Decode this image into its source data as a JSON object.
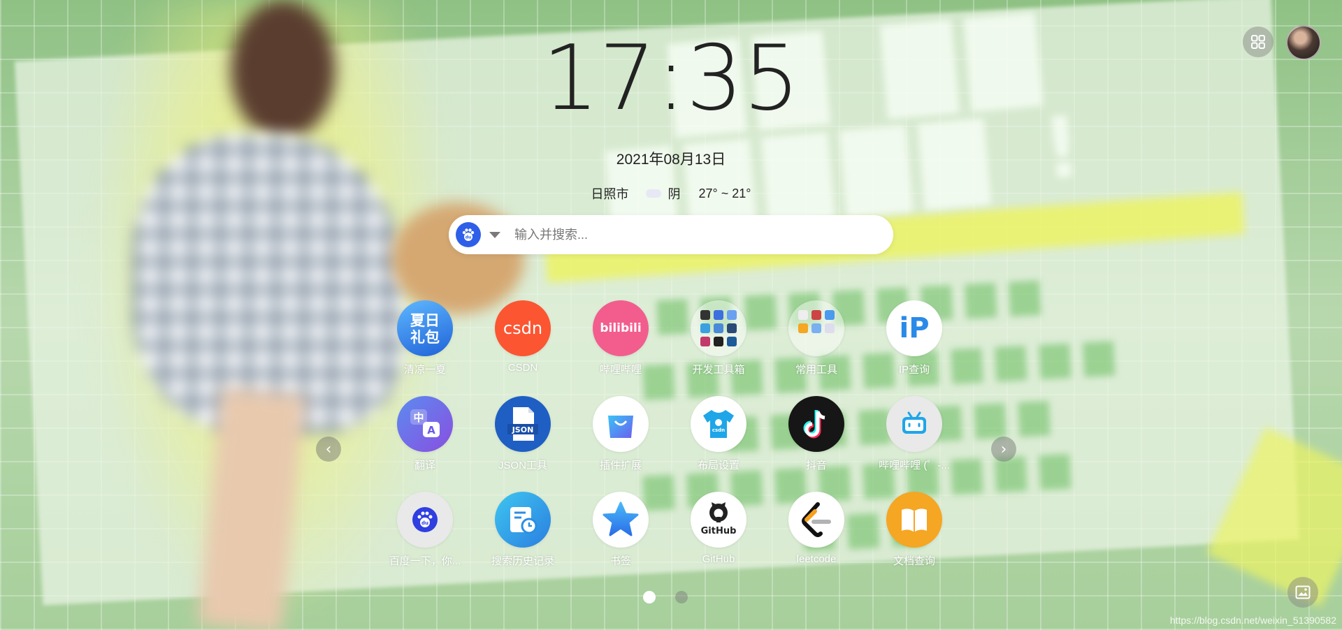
{
  "clock": {
    "time": "17:35",
    "date": "2021年08月13日"
  },
  "weather": {
    "city": "日照市",
    "condition": "阴",
    "temperature": "27° ~ 21°",
    "icon": "cloud-icon"
  },
  "search": {
    "placeholder": "输入并搜索...",
    "engine_icon": "baidu-paw-icon",
    "engine_label": "du"
  },
  "apps": [
    {
      "label": "清凉一夏",
      "icon": "summer-gift-icon",
      "badge": "夏日\n礼包",
      "color": "#2b7ee8"
    },
    {
      "label": "CSDN",
      "icon": "csdn-icon",
      "badge": "csdn",
      "color": "#fc5531"
    },
    {
      "label": "哔哩哔哩",
      "icon": "bilibili-icon",
      "badge": "bilibili",
      "color": "#f25d8e"
    },
    {
      "label": "开发工具箱",
      "icon": "folder-icon",
      "badge": "",
      "color": ""
    },
    {
      "label": "常用工具",
      "icon": "folder-icon",
      "badge": "",
      "color": ""
    },
    {
      "label": "IP查询",
      "icon": "ip-icon",
      "badge": "iP",
      "color": "#ffffff"
    },
    {
      "label": "翻译",
      "icon": "translate-icon",
      "badge": "中A",
      "color": "#6f5de8"
    },
    {
      "label": "JSON工具",
      "icon": "json-icon",
      "badge": "JSON",
      "color": "#1f5fc4"
    },
    {
      "label": "插件扩展",
      "icon": "shopping-bag-icon",
      "badge": "",
      "color": "#ffffff"
    },
    {
      "label": "布局设置",
      "icon": "tshirt-icon",
      "badge": "csdn",
      "color": "#ffffff"
    },
    {
      "label": "抖音",
      "icon": "tiktok-icon",
      "badge": "♪",
      "color": "#161616"
    },
    {
      "label": "哔哩哔哩 (゜-...",
      "icon": "bilibili-tv-icon",
      "badge": "",
      "color": "#e9e9e9"
    },
    {
      "label": "百度一下，你...",
      "icon": "baidu-icon",
      "badge": "du",
      "color": "#e9e9e9"
    },
    {
      "label": "搜索历史记录",
      "icon": "history-icon",
      "badge": "",
      "color": "#2aa4e4"
    },
    {
      "label": "书签",
      "icon": "star-icon",
      "badge": "★",
      "color": "#ffffff"
    },
    {
      "label": "GitHub",
      "icon": "github-icon",
      "badge": "GitHub",
      "color": "#ffffff"
    },
    {
      "label": "leetcode",
      "icon": "leetcode-icon",
      "badge": "",
      "color": "#ffffff"
    },
    {
      "label": "文档查询",
      "icon": "book-icon",
      "badge": "",
      "color": "#f5a623"
    }
  ],
  "pager": {
    "pages": 2,
    "current": 1
  },
  "watermark": "https://blog.csdn.net/weixin_51390582",
  "accent": "#2f5fe8"
}
